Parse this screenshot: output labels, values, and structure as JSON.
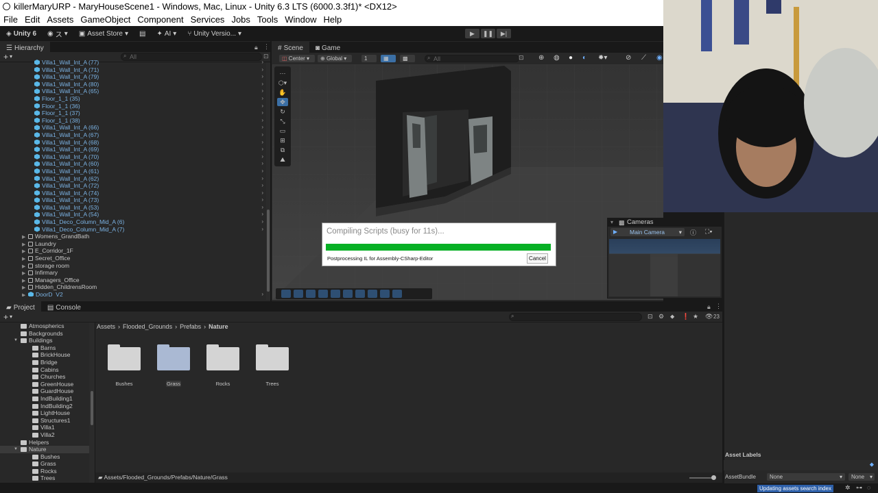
{
  "window": {
    "title": "killerMaryURP - MaryHouseScene1 - Windows, Mac, Linux - Unity 6.3 LTS (6000.3.3f1)* <DX12>"
  },
  "menu": [
    "File",
    "Edit",
    "Assets",
    "GameObject",
    "Component",
    "Services",
    "Jobs",
    "Tools",
    "Window",
    "Help"
  ],
  "toolbar": {
    "unity_label": "Unity 6",
    "account_label": "ス",
    "asset_store": "Asset Store",
    "ai": "AI",
    "version_control": "Unity Versio..."
  },
  "hierarchy": {
    "tab": "Hierarchy",
    "search_placeholder": "All",
    "rows": [
      {
        "label": "Villa1_Wall_Int_A (77)",
        "type": "prefab",
        "indent": 1
      },
      {
        "label": "Villa1_Wall_Int_A (71)",
        "type": "prefab",
        "indent": 1
      },
      {
        "label": "Villa1_Wall_Int_A (79)",
        "type": "prefab",
        "indent": 1
      },
      {
        "label": "Villa1_Wall_Int_A (80)",
        "type": "prefab",
        "indent": 1
      },
      {
        "label": "Villa1_Wall_Int_A (65)",
        "type": "prefab",
        "indent": 1
      },
      {
        "label": "Floor_1_1 (35)",
        "type": "prefab",
        "indent": 1
      },
      {
        "label": "Floor_1_1 (36)",
        "type": "prefab",
        "indent": 1
      },
      {
        "label": "Floor_1_1 (37)",
        "type": "prefab",
        "indent": 1
      },
      {
        "label": "Floor_1_1 (38)",
        "type": "prefab",
        "indent": 1
      },
      {
        "label": "Villa1_Wall_Int_A (66)",
        "type": "prefab",
        "indent": 1
      },
      {
        "label": "Villa1_Wall_Int_A (67)",
        "type": "prefab",
        "indent": 1
      },
      {
        "label": "Villa1_Wall_Int_A (68)",
        "type": "prefab",
        "indent": 1
      },
      {
        "label": "Villa1_Wall_Int_A (69)",
        "type": "prefab",
        "indent": 1
      },
      {
        "label": "Villa1_Wall_Int_A (70)",
        "type": "prefab",
        "indent": 1
      },
      {
        "label": "Villa1_Wall_Int_A (60)",
        "type": "prefab",
        "indent": 1
      },
      {
        "label": "Villa1_Wall_Int_A (61)",
        "type": "prefab",
        "indent": 1
      },
      {
        "label": "Villa1_Wall_Int_A (62)",
        "type": "prefab",
        "indent": 1
      },
      {
        "label": "Villa1_Wall_Int_A (72)",
        "type": "prefab",
        "indent": 1
      },
      {
        "label": "Villa1_Wall_Int_A (74)",
        "type": "prefab",
        "indent": 1
      },
      {
        "label": "Villa1_Wall_Int_A (73)",
        "type": "prefab",
        "indent": 1
      },
      {
        "label": "Villa1_Wall_Int_A (53)",
        "type": "prefab",
        "indent": 1
      },
      {
        "label": "Villa1_Wall_Int_A (54)",
        "type": "prefab",
        "indent": 1
      },
      {
        "label": "Villa1_Deco_Column_Mid_A (6)",
        "type": "prefab",
        "indent": 1
      },
      {
        "label": "Villa1_Deco_Column_Mid_A (7)",
        "type": "prefab",
        "indent": 1
      },
      {
        "label": "Womens_GrandBath",
        "type": "object",
        "indent": 0
      },
      {
        "label": "Laundry",
        "type": "object",
        "indent": 0
      },
      {
        "label": "E_Corridor_1F",
        "type": "object",
        "indent": 0
      },
      {
        "label": "Secret_Office",
        "type": "object",
        "indent": 0
      },
      {
        "label": "storage room",
        "type": "object",
        "indent": 0
      },
      {
        "label": "Infirmary",
        "type": "object",
        "indent": 0
      },
      {
        "label": "Managers_Office",
        "type": "object",
        "indent": 0
      },
      {
        "label": "Hidden_ChildrensRoom",
        "type": "object",
        "indent": 0
      },
      {
        "label": "DoorD_V2",
        "type": "prefab",
        "indent": 0
      }
    ]
  },
  "scene": {
    "tab_scene": "Scene",
    "tab_game": "Game",
    "pivot": "Center",
    "space": "Global",
    "grid_value": "1",
    "search_placeholder": "All"
  },
  "compile_dialog": {
    "title": "Compiling Scripts (busy for 11s)...",
    "message": "Postprocessing IL for Assembly-CSharp-Editor",
    "cancel": "Cancel",
    "progress": 1.0
  },
  "cameras": {
    "title": "Cameras",
    "selected": "Main Camera"
  },
  "project": {
    "tab_project": "Project",
    "tab_console": "Console",
    "hidden_count": "23",
    "tree": [
      {
        "label": "Atmospherics",
        "indent": 1,
        "expanded": null
      },
      {
        "label": "Backgrounds",
        "indent": 1,
        "expanded": null
      },
      {
        "label": "Buildings",
        "indent": 1,
        "expanded": true
      },
      {
        "label": "Barns",
        "indent": 2,
        "expanded": null
      },
      {
        "label": "BrickHouse",
        "indent": 2,
        "expanded": null
      },
      {
        "label": "Bridge",
        "indent": 2,
        "expanded": null
      },
      {
        "label": "Cabins",
        "indent": 2,
        "expanded": null
      },
      {
        "label": "Churches",
        "indent": 2,
        "expanded": null
      },
      {
        "label": "GreenHouse",
        "indent": 2,
        "expanded": null
      },
      {
        "label": "GuardHouse",
        "indent": 2,
        "expanded": null
      },
      {
        "label": "IndBuilding1",
        "indent": 2,
        "expanded": null
      },
      {
        "label": "IndBuilding2",
        "indent": 2,
        "expanded": null
      },
      {
        "label": "LightHouse",
        "indent": 2,
        "expanded": null
      },
      {
        "label": "Structures1",
        "indent": 2,
        "expanded": null
      },
      {
        "label": "Villa1",
        "indent": 2,
        "expanded": null
      },
      {
        "label": "Villa2",
        "indent": 2,
        "expanded": null
      },
      {
        "label": "Helpers",
        "indent": 1,
        "expanded": null
      },
      {
        "label": "Nature",
        "indent": 1,
        "expanded": true,
        "selected": true
      },
      {
        "label": "Bushes",
        "indent": 2,
        "expanded": null
      },
      {
        "label": "Grass",
        "indent": 2,
        "expanded": null
      },
      {
        "label": "Rocks",
        "indent": 2,
        "expanded": null
      },
      {
        "label": "Trees",
        "indent": 2,
        "expanded": null
      }
    ],
    "breadcrumb": [
      "Assets",
      "Flooded_Grounds",
      "Prefabs",
      "Nature"
    ],
    "folders": [
      {
        "label": "Bushes",
        "selected": false
      },
      {
        "label": "Grass",
        "selected": true
      },
      {
        "label": "Rocks",
        "selected": false
      },
      {
        "label": "Trees",
        "selected": false
      }
    ],
    "path": "Assets/Flooded_Grounds/Prefabs/Nature/Grass"
  },
  "inspector": {
    "asset_labels": "Asset Labels",
    "assetbundle_label": "AssetBundle",
    "assetbundle_value": "None",
    "variant_value": "None"
  },
  "status": {
    "updating": "Updating assets search index"
  }
}
